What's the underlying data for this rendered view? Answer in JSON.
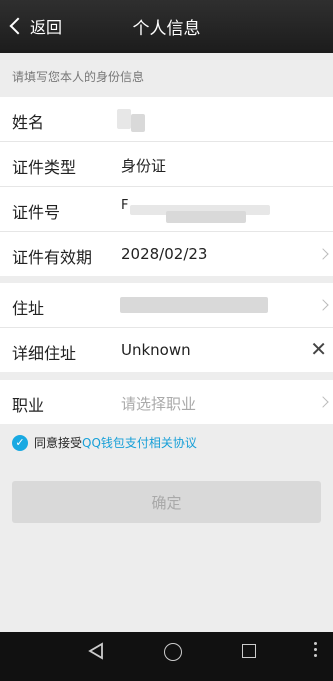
{
  "header": {
    "back_label": "返回",
    "title": "个人信息"
  },
  "hint": "请填写您本人的身份信息",
  "form": {
    "name_label": "姓名",
    "id_type_label": "证件类型",
    "id_type_value": "身份证",
    "id_number_label": "证件号",
    "id_number_prefix": "F",
    "validity_label": "证件有效期",
    "validity_value": "2028/02/23",
    "address_label": "住址",
    "detail_address_label": "详细住址",
    "detail_address_value": "Unknown",
    "occupation_label": "职业",
    "occupation_placeholder": "请选择职业"
  },
  "agreement": {
    "prefix": "同意接受",
    "link": "QQ钱包支付相关协议"
  },
  "confirm_label": "确定",
  "colors": {
    "accent": "#18a9e2",
    "link": "#18a0d8",
    "header_bg": "#1c1c1c"
  }
}
